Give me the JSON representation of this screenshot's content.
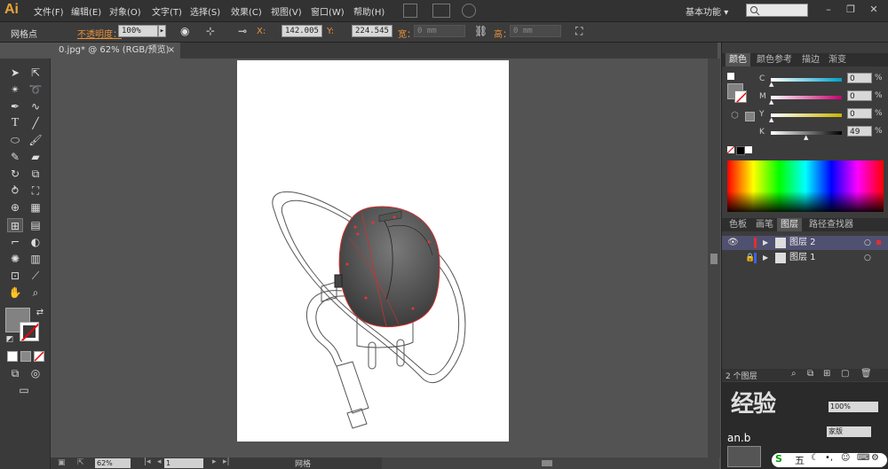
{
  "app": {
    "logo": "Ai",
    "menus": [
      "文件(F)",
      "编辑(E)",
      "对象(O)",
      "文字(T)",
      "选择(S)",
      "效果(C)",
      "视图(V)",
      "窗口(W)",
      "帮助(H)"
    ],
    "workspace": "基本功能",
    "workspace_arrow": "▾",
    "search_icon": "search-icon",
    "window_controls": [
      "–",
      "❐",
      "✕"
    ]
  },
  "controlbar": {
    "tool_name": "网格点",
    "opacity_label": "不透明度：",
    "opacity_value": "100%",
    "x_label": "X:",
    "x_value": "142.005",
    "y_label": "Y:",
    "y_value": "224.545",
    "w_label": "宽：",
    "w_value": "0 mm",
    "h_label": "高：",
    "h_value": "0 mm"
  },
  "document": {
    "tab_label": "0.jpg* @ 62% (RGB/预览)",
    "close": "×"
  },
  "status": {
    "zoom": "62%",
    "page": "1",
    "tool": "网格"
  },
  "color_panel": {
    "tabs": [
      "颜色",
      "颜色参考",
      "描边",
      "渐变"
    ],
    "active_tab": "颜色",
    "sliders": [
      {
        "label": "C",
        "value": "0",
        "color": "#00a0c6"
      },
      {
        "label": "M",
        "value": "0",
        "color": "#c8006e"
      },
      {
        "label": "Y",
        "value": "0",
        "color": "#c8b400"
      },
      {
        "label": "K",
        "value": "49",
        "color": "#000000"
      }
    ],
    "fill_color": "#828282"
  },
  "layers_panel": {
    "tabs": [
      "色板",
      "画笔",
      "图层",
      "路径查找器"
    ],
    "active_tab": "图层",
    "layers": [
      {
        "name": "图层 2",
        "color": "#e03030",
        "visible": true,
        "locked": false
      },
      {
        "name": "图层 1",
        "color": "#4060e0",
        "visible": false,
        "locked": true
      }
    ],
    "count": "2 个图层"
  },
  "watermark": {
    "lines": [
      "经验",
      "an.b"
    ],
    "badge": "100%",
    "extra": "家版"
  },
  "taskbar": {
    "ime": "五"
  }
}
